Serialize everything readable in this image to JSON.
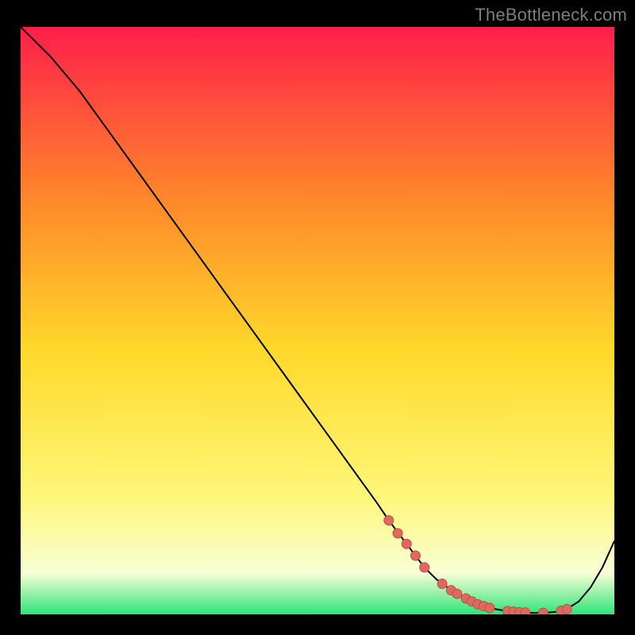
{
  "watermark": "TheBottleneck.com",
  "colors": {
    "gradient_top": "#ff1f4a",
    "gradient_mid1": "#ff8a2a",
    "gradient_mid2": "#ffd92a",
    "gradient_mid3": "#fff77a",
    "gradient_bottom_pale": "#f8ffd6",
    "gradient_bottom_green": "#2fe47a",
    "curve": "#000000",
    "marker_fill": "#e0695f",
    "marker_stroke": "#bd4f47",
    "frame_bg": "#000000"
  },
  "chart_data": {
    "type": "line",
    "title": "",
    "xlabel": "",
    "ylabel": "",
    "xlim": [
      0,
      100
    ],
    "ylim": [
      0,
      100
    ],
    "series": [
      {
        "name": "bottleneck-curve",
        "x": [
          0,
          5,
          10,
          15,
          20,
          25,
          30,
          35,
          40,
          45,
          50,
          55,
          60,
          62,
          65,
          68,
          70,
          72,
          74,
          76,
          78,
          80,
          82,
          84,
          86,
          88,
          90,
          92,
          94,
          96,
          98,
          100
        ],
        "y": [
          100,
          95,
          89,
          82,
          75,
          68,
          61,
          54,
          47,
          40,
          33,
          26,
          19,
          16,
          12,
          8,
          6,
          4.5,
          3.2,
          2.2,
          1.4,
          0.9,
          0.55,
          0.35,
          0.25,
          0.25,
          0.4,
          0.9,
          2.2,
          4.6,
          8,
          12.5
        ]
      }
    ],
    "markers": [
      {
        "x": 62,
        "y": 16
      },
      {
        "x": 63.5,
        "y": 13.8
      },
      {
        "x": 65,
        "y": 12
      },
      {
        "x": 66.5,
        "y": 10.0
      },
      {
        "x": 68,
        "y": 8
      },
      {
        "x": 71,
        "y": 5.2
      },
      {
        "x": 72.5,
        "y": 4.1
      },
      {
        "x": 73.5,
        "y": 3.5
      },
      {
        "x": 75,
        "y": 2.7
      },
      {
        "x": 76,
        "y": 2.2
      },
      {
        "x": 77,
        "y": 1.7
      },
      {
        "x": 78,
        "y": 1.4
      },
      {
        "x": 79,
        "y": 1.1
      },
      {
        "x": 82,
        "y": 0.55
      },
      {
        "x": 83,
        "y": 0.45
      },
      {
        "x": 84,
        "y": 0.35
      },
      {
        "x": 85,
        "y": 0.3
      },
      {
        "x": 88,
        "y": 0.25
      },
      {
        "x": 91,
        "y": 0.6
      },
      {
        "x": 92,
        "y": 0.9
      }
    ],
    "marker_radius": 6
  }
}
